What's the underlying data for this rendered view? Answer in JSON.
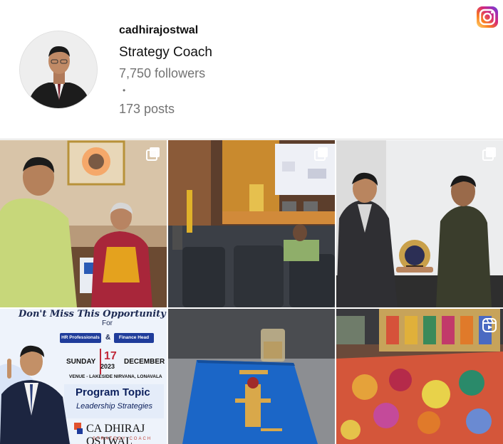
{
  "profile": {
    "username": "cadhirajostwal",
    "full_name": "Strategy Coach",
    "followers": "7,750 followers",
    "separator": "•",
    "posts": "173 posts",
    "avatar_icon": "profile-photo-icon"
  },
  "brand_icon": "instagram-icon",
  "colors": {
    "instagram_gradient": [
      "#feda75",
      "#fa7e1e",
      "#d62976",
      "#962fbf",
      "#4f5bd5"
    ],
    "divider": "#dbdbdb",
    "muted_text": "#737373"
  },
  "grid": [
    {
      "id": "post-1",
      "badge": "carousel-icon",
      "description_icon": "photo-icon"
    },
    {
      "id": "post-2",
      "badge": "carousel-icon",
      "description_icon": "photo-icon"
    },
    {
      "id": "post-3",
      "badge": "carousel-icon",
      "description_icon": "photo-icon"
    },
    {
      "id": "post-4",
      "badge": "",
      "description_icon": "photo-icon"
    },
    {
      "id": "post-5",
      "badge": "",
      "description_icon": "photo-icon"
    },
    {
      "id": "post-6",
      "badge": "reel-icon",
      "description_icon": "photo-icon"
    }
  ],
  "promo": {
    "headline": "Don't Miss This Opportunity",
    "for": "For",
    "pill_1": "HR Professionals",
    "amp": "&",
    "pill_2": "Finance Head",
    "day": "SUNDAY",
    "date": "17",
    "year": "2023",
    "month": "DECEMBER",
    "venue": "VENUE - LAKESIDE NIRVANA, LONAVALA",
    "topic": "Program Topic",
    "topic_sub": "Leadership Strategies",
    "brand": "CA DHIRAJ OSTWAL",
    "brand_sub": "STRATEGY COACH"
  }
}
